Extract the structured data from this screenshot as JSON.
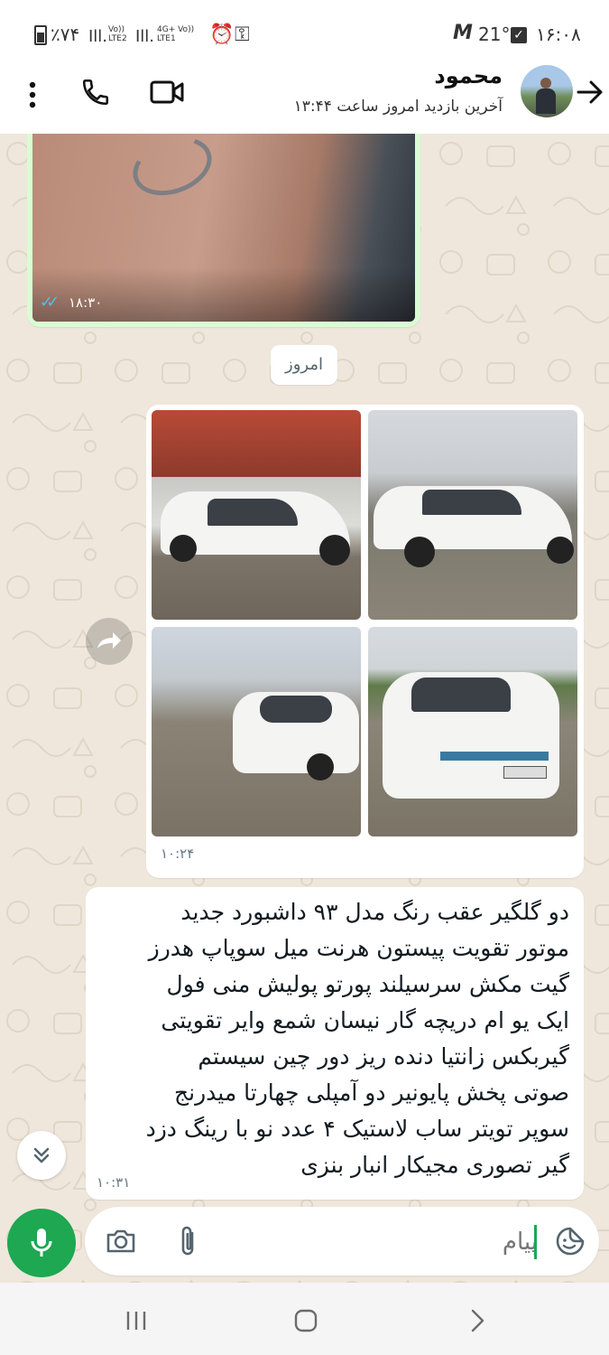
{
  "status_bar": {
    "battery": "٪۷۴",
    "network1": "Vo)) LTE2",
    "network2": "4G+ Vo)) LTE1",
    "temperature": "21°",
    "time": "۱۶:۰۸"
  },
  "header": {
    "contact_name": "محمود",
    "last_seen": "آخرین بازدید امروز ساعت ۱۳:۴۴"
  },
  "messages": {
    "image_message_time": "۱۸:۳۰",
    "date_divider": "امروز",
    "album_time": "۱۰:۲۴",
    "text_message": "دو گلگیر عقب رنگ  مدل ۹۳ داشبورد جدید\nموتور تقویت پیستون هرنت میل سوپاپ هدرز\nگیت مکش سرسیلند پورتو پولیش منی فول\nایک یو ام دریچه گار نیسان شمع وایر تقویتی\nگیربکس زانتیا دنده ریز  دور چین سیستم\nصوتی پخش پایونیر دو آمپلی چهارتا میدرنج\nسوپر تویتر ساب لاستیک ۴ عدد نو با رینگ دزد\nگیر تصوری مجیکار انبار بنزی",
    "text_message_time": "۱۰:۳۱"
  },
  "composer": {
    "placeholder": "پیام"
  },
  "colors": {
    "accent_green": "#1da851",
    "chat_bg": "#efe7dc",
    "outgoing_bubble": "#d9fdd3",
    "read_ticks": "#53bdeb"
  },
  "icons": [
    "more-icon",
    "phone-icon",
    "video-icon",
    "back-arrow-icon",
    "forward-icon",
    "scroll-down-icon",
    "mic-icon",
    "camera-icon",
    "attach-icon",
    "sticker-icon",
    "recent-apps-icon",
    "home-icon",
    "nav-back-icon"
  ]
}
